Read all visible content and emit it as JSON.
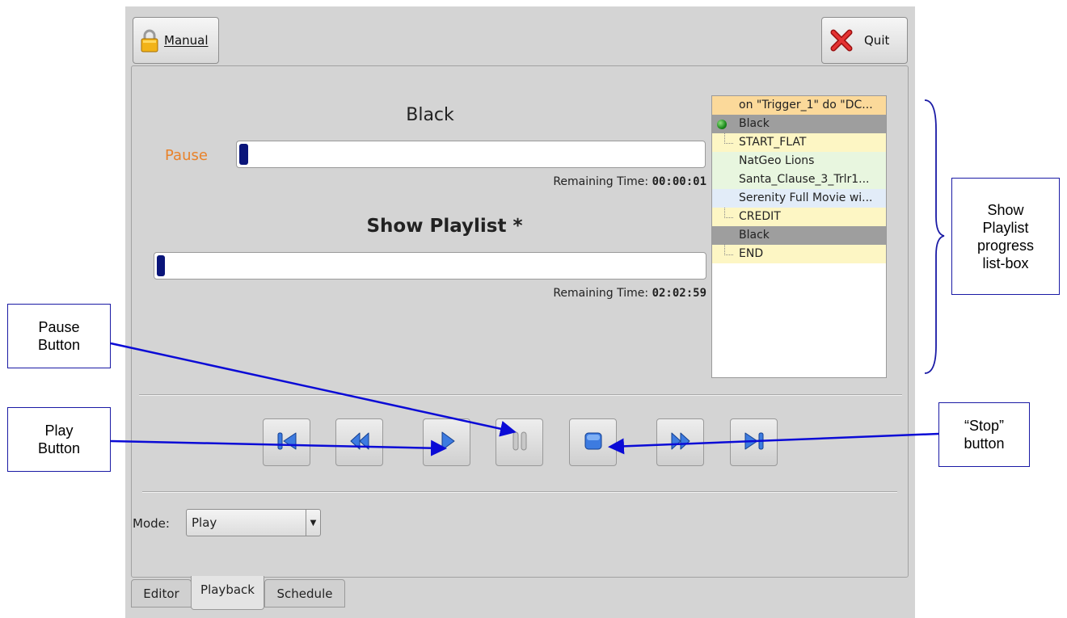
{
  "toolbar": {
    "manual_label": "Manual",
    "quit_label": "Quit"
  },
  "current_item": {
    "title": "Black",
    "state_label": "Pause",
    "progress_fraction": 0.02,
    "remaining_label": "Remaining Time:",
    "remaining_time": "00:00:01"
  },
  "playlist": {
    "title": "Show Playlist *",
    "progress_fraction": 0.015,
    "remaining_label": "Remaining Time:",
    "remaining_time": "02:02:59"
  },
  "listbox": {
    "items": [
      {
        "label": "on \"Trigger_1\" do \"DC...",
        "bg": "#fbd99a",
        "marker": "none"
      },
      {
        "label": "Black",
        "bg": "#9e9e9e",
        "marker": "dot"
      },
      {
        "label": "START_FLAT",
        "bg": "#fdf6c4",
        "marker": "tree"
      },
      {
        "label": "NatGeo Lions",
        "bg": "#e8f6df",
        "marker": "none"
      },
      {
        "label": "Santa_Clause_3_Trlr1...",
        "bg": "#e8f6df",
        "marker": "none"
      },
      {
        "label": "Serenity Full Movie wi...",
        "bg": "#e2ecf8",
        "marker": "none"
      },
      {
        "label": "CREDIT",
        "bg": "#fdf6c4",
        "marker": "tree"
      },
      {
        "label": "Black",
        "bg": "#9e9e9e",
        "marker": "none"
      },
      {
        "label": "END",
        "bg": "#fdf6c4",
        "marker": "tree"
      }
    ]
  },
  "transport": {
    "buttons": [
      {
        "name": "skip-to-start-button",
        "icon": "skip-to-start-icon"
      },
      {
        "name": "rewind-button",
        "icon": "rewind-icon"
      },
      {
        "name": "play-button",
        "icon": "play-icon"
      },
      {
        "name": "pause-button",
        "icon": "pause-icon"
      },
      {
        "name": "stop-button",
        "icon": "stop-icon"
      },
      {
        "name": "fast-forward-button",
        "icon": "fast-forward-icon"
      },
      {
        "name": "skip-to-end-button",
        "icon": "skip-to-end-icon"
      }
    ]
  },
  "mode": {
    "label": "Mode:",
    "value": "Play"
  },
  "tabs": [
    {
      "label": "Editor",
      "active": false
    },
    {
      "label": "Playback",
      "active": true
    },
    {
      "label": "Schedule",
      "active": false
    }
  ],
  "annotations": {
    "pause_button": "Pause Button",
    "play_button": "Play Button",
    "stop_button": "“Stop” button",
    "listbox": "Show Playlist progress list-box"
  },
  "colors": {
    "pause_label": "#e8822a",
    "progress_fill": "#0a157a",
    "icon_blue": "#1a5cc8",
    "annotation_line": "#0b0bd6"
  }
}
